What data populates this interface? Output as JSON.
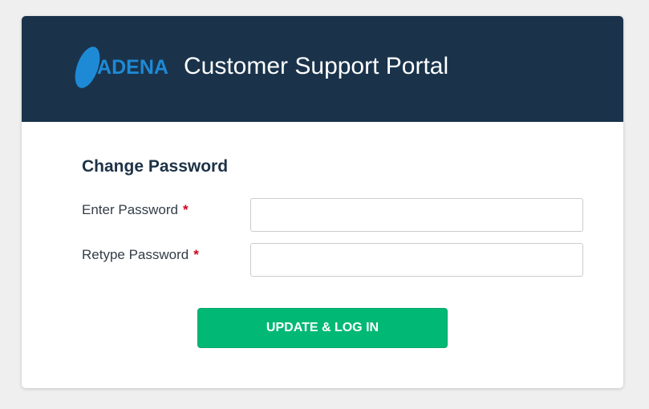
{
  "header": {
    "logo_text": "CADENA",
    "title": "Customer Support Portal"
  },
  "form": {
    "title": "Change Password",
    "fields": [
      {
        "label": "Enter Password",
        "required_marker": "*",
        "value": "",
        "placeholder": ""
      },
      {
        "label": "Retype Password",
        "required_marker": "*",
        "value": "",
        "placeholder": ""
      }
    ],
    "submit_label": "UPDATE & LOG IN"
  },
  "colors": {
    "page_background": "#efefef",
    "header_background": "#1a334b",
    "brand_blue": "#1e8ad6",
    "button_green": "#02b875",
    "required_red": "#d0021b"
  },
  "icons": {
    "logo": "cadena-logo-icon"
  }
}
